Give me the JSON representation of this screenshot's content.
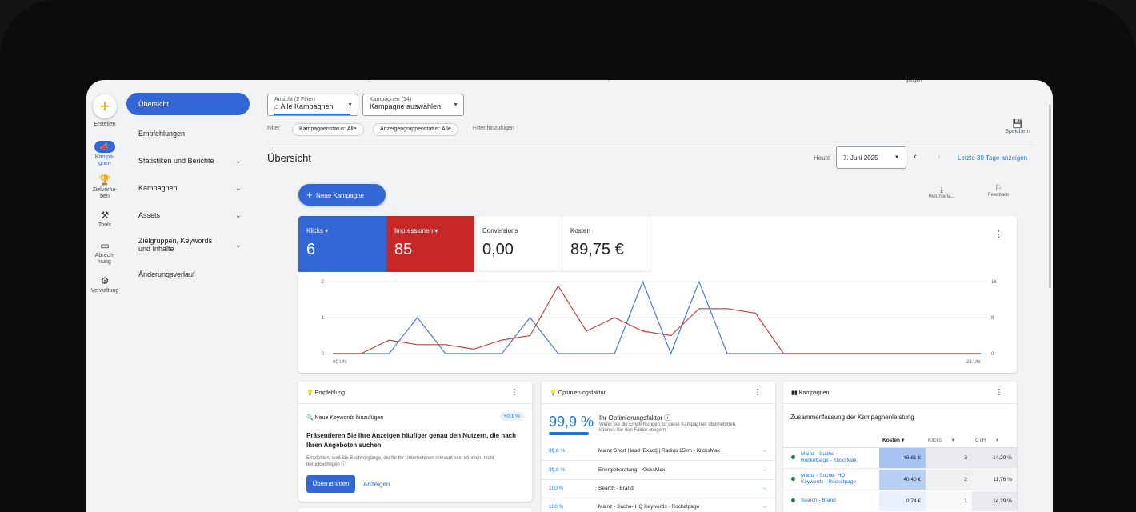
{
  "topbar": {
    "stub_text": "gungen"
  },
  "rail": [
    {
      "label": "Erstellen",
      "icon": "plus-icon"
    },
    {
      "label": "Kampa-\ngnen",
      "icon": "campaign-icon"
    },
    {
      "label": "Zielvorha-\nben",
      "icon": "trophy-icon"
    },
    {
      "label": "Tools",
      "icon": "tools-icon"
    },
    {
      "label": "Abrech-\nnung",
      "icon": "card-icon"
    },
    {
      "label": "Verwaltung",
      "icon": "gear-icon"
    }
  ],
  "nav": [
    {
      "label": "Übersicht"
    },
    {
      "label": "Empfehlungen"
    },
    {
      "label": "Statistiken und Berichte"
    },
    {
      "label": "Kampagnen"
    },
    {
      "label": "Assets"
    },
    {
      "label": "Zielgruppen, Keywords\nund Inhalte"
    },
    {
      "label": "Änderungsverlauf"
    }
  ],
  "view": {
    "label": "Ansicht (2 Filter)",
    "value": "Alle Kampagnen"
  },
  "campaigns_select": {
    "label": "Kampagnen (14)",
    "value": "Kampagne auswählen"
  },
  "filter": {
    "label": "Filter",
    "chips": [
      "Kampagnenstatus: Alle",
      "Anzeigengruppenstatus: Alle"
    ],
    "add": "Filter hinzufügen"
  },
  "save": "Speichern",
  "page_title": "Übersicht",
  "date": {
    "today": "Heute",
    "value": "7. Juni 2025",
    "last30": "Letzte 30 Tage anzeigen"
  },
  "new_campaign": "Neue Kampagne",
  "download": "Herunterla...",
  "feedback": "Feedback",
  "metrics": [
    {
      "label": "Klicks",
      "value": "6",
      "color": "#4285f4"
    },
    {
      "label": "Impressionen",
      "value": "85",
      "color": "#d32f2f"
    },
    {
      "label": "Conversions",
      "value": "0,00"
    },
    {
      "label": "Kosten",
      "value": "89,75 €"
    }
  ],
  "chart_data": {
    "type": "line",
    "xlabels": [
      "00 Uhr",
      "23 Uhr"
    ],
    "y_left": [
      0,
      1,
      2
    ],
    "y_right": [
      0,
      8,
      16
    ],
    "series": [
      {
        "name": "Klicks",
        "color": "#4a7ad8",
        "values": [
          0,
          0,
          0,
          1,
          0,
          0,
          0,
          1,
          0,
          0,
          0,
          2,
          0,
          2,
          0,
          0,
          0,
          0,
          0,
          0,
          0,
          0,
          0,
          0
        ]
      },
      {
        "name": "Impressionen",
        "color": "#c0443a",
        "values": [
          0,
          0,
          3,
          2,
          2,
          1,
          3,
          4,
          15,
          5,
          8,
          5,
          4,
          10,
          10,
          9,
          0,
          0,
          0,
          0,
          0,
          0,
          0,
          0
        ]
      }
    ]
  },
  "empfehlung": {
    "title": "Empfehlung",
    "item": "Neue Keywords hinzufügen",
    "badge": "+0,1 %",
    "headline": "Präsentieren Sie Ihre Anzeigen häufiger genau den Nutzern, die nach Ihren Angeboten suchen",
    "desc": "Empfohlen, weil Sie Suchvorgänge, die für Ihr Unternehmen relevant sein könnten, nicht berücksichtigen",
    "apply": "Übernehmen",
    "show": "Anzeigen"
  },
  "opt": {
    "title": "Optimierungsfaktor",
    "score": "99,9 %",
    "heading": "Ihr Optimierungsfaktor",
    "sub": "Wenn Sie die Empfehlungen für diese Kampagnen übernehmen, können Sie den Faktor steigern",
    "rows": [
      {
        "p": "99,8 %",
        "t": "Mainz Short Head [Exact] | Radius 15km - KlicksMax"
      },
      {
        "p": "99,8 %",
        "t": "Energieberatung - KlicksMax"
      },
      {
        "p": "100 %",
        "t": "Search - Brand"
      },
      {
        "p": "100 %",
        "t": "Mainz - Suche- HQ Keywords - Rocketpage"
      }
    ]
  },
  "kamp": {
    "title": "Kampagnen",
    "heading": "Zusammenfassung der Kampagnenleistung",
    "cols": [
      "Kosten",
      "Klicks",
      "CTR"
    ],
    "rows": [
      {
        "name": "Mainz - Suche -\nRocketpage - KlicksMax",
        "k": "48,61 €",
        "c": "3",
        "ctr": "14,29 %"
      },
      {
        "name": "Mainz - Suche- HQ\nKeywords - Rocketpage",
        "k": "40,40 €",
        "c": "2",
        "ctr": "11,76 %"
      },
      {
        "name": "Search - Brand",
        "k": "0,74 €",
        "c": "1",
        "ctr": "14,29 %"
      }
    ]
  }
}
